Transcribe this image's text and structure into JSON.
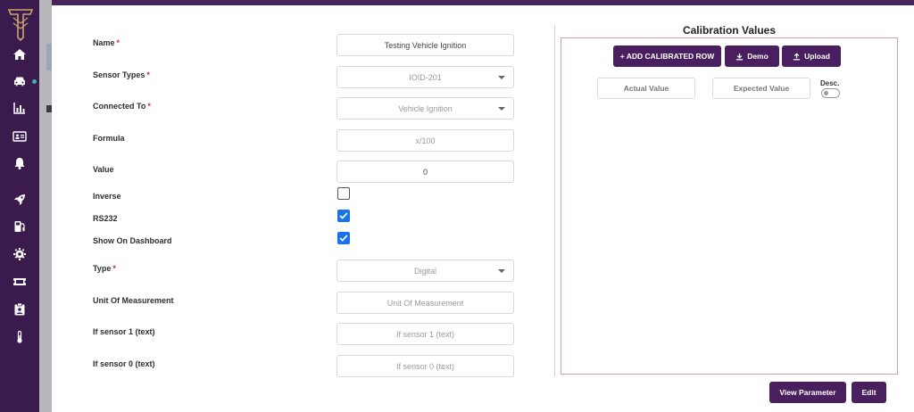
{
  "sidebar": {
    "items": [
      {
        "icon": "home-icon"
      },
      {
        "icon": "car-icon"
      },
      {
        "icon": "bar-chart-icon"
      },
      {
        "icon": "id-card-icon"
      },
      {
        "icon": "bell-icon"
      },
      {
        "icon": "rocket-icon"
      },
      {
        "icon": "fuel-pump-icon"
      },
      {
        "icon": "gear-icon"
      },
      {
        "icon": "ticket-icon"
      },
      {
        "icon": "clipboard-user-icon"
      },
      {
        "icon": "thermometer-icon"
      }
    ]
  },
  "form": {
    "name_label": "Name",
    "name_value": "Testing Vehicle Ignition",
    "sensor_types_label": "Sensor Types",
    "sensor_types_value": "IOID-201",
    "connected_to_label": "Connected To",
    "connected_to_value": "Vehicle Ignition",
    "formula_label": "Formula",
    "formula_placeholder": "x/100",
    "value_label": "Value",
    "value_value": "0",
    "inverse_label": "Inverse",
    "inverse_checked": false,
    "rs232_label": "RS232",
    "rs232_checked": true,
    "show_on_dashboard_label": "Show On Dashboard",
    "show_on_dashboard_checked": true,
    "type_label": "Type",
    "type_value": "Digital",
    "unit_label": "Unit Of Measurement",
    "unit_placeholder": "Unit Of Measurement",
    "if_sensor_1_label": "If sensor 1 (text)",
    "if_sensor_1_placeholder": "If sensor 1 (text)",
    "if_sensor_0_label": "If sensor 0 (text)",
    "if_sensor_0_placeholder": "If sensor 0 (text)",
    "required_marker": "*"
  },
  "calibration": {
    "title": "Calibration Values",
    "add_row_label": "+ ADD CALIBRATED ROW",
    "demo_label": "Demo",
    "upload_label": "Upload",
    "actual_value_label": "Actual Value",
    "expected_value_label": "Expected Value",
    "desc_label": "Desc.",
    "desc_toggle_on": false
  },
  "footer": {
    "view_parameter_label": "View Parameter",
    "edit_label": "Edit"
  },
  "colors": {
    "sidebar_bg": "#3b1a4e",
    "primary_button": "#4a1f60",
    "checkbox_checked": "#1a73e8",
    "required": "#d32f2f"
  }
}
